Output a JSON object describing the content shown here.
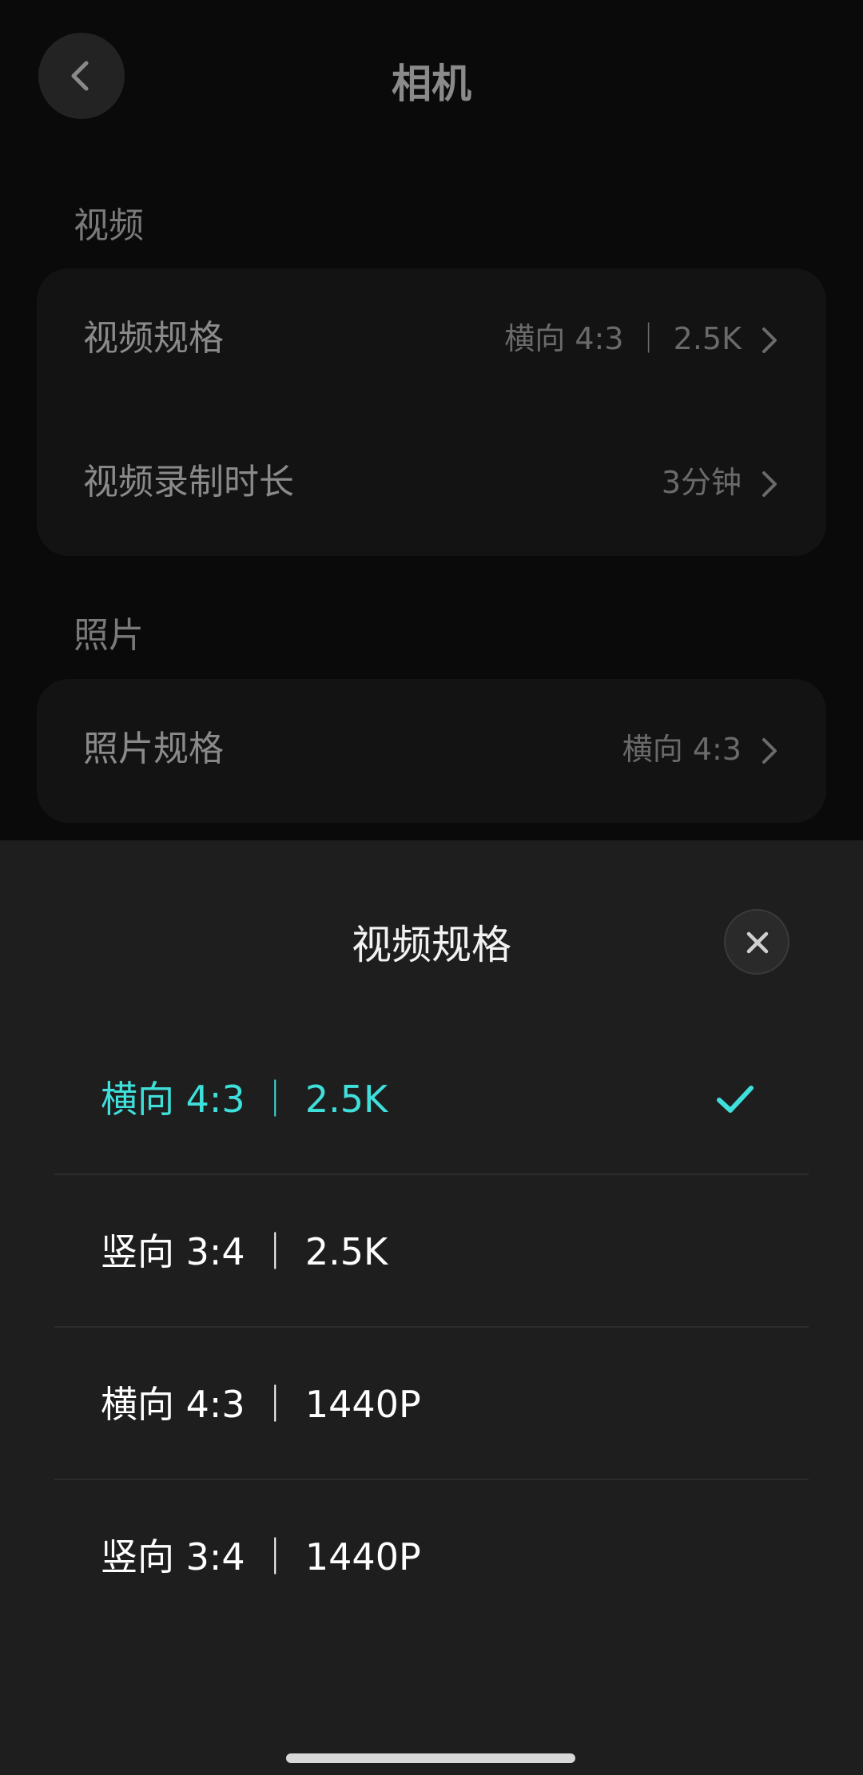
{
  "header": {
    "title": "相机",
    "back_icon": "chevron-left-icon"
  },
  "video_section": {
    "label": "视频",
    "rows": [
      {
        "label": "视频规格",
        "value": "横向 4:3 ｜ 2.5K"
      },
      {
        "label": "视频录制时长",
        "value": "3分钟"
      }
    ]
  },
  "photo_section": {
    "label": "照片",
    "rows": [
      {
        "label": "照片规格",
        "value": "横向 4:3"
      }
    ]
  },
  "sheet": {
    "title": "视频规格",
    "close_icon": "close-icon",
    "options": [
      {
        "label": "横向 4:3 ｜ 2.5K",
        "selected": true
      },
      {
        "label": "竖向 3:4 ｜ 2.5K",
        "selected": false
      },
      {
        "label": "横向 4:3 ｜ 1440P",
        "selected": false
      },
      {
        "label": "竖向 3:4 ｜ 1440P",
        "selected": false
      }
    ]
  },
  "colors": {
    "accent": "#3fe0dc",
    "sheet_background": "#1e1e1e",
    "page_background": "#0a0a0a"
  }
}
